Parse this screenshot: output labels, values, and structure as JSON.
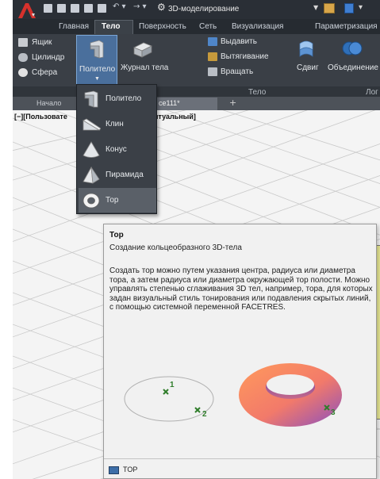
{
  "titlebar": {
    "workspace_label": "3D-моделирование",
    "icons": [
      "autocad-logo-icon",
      "new-icon",
      "open-icon",
      "save-icon",
      "saveas-icon",
      "print-icon",
      "undo-icon",
      "redo-icon",
      "gear-icon",
      "dropdown-icon"
    ]
  },
  "tabs": [
    {
      "label": "Главная",
      "active": false
    },
    {
      "label": "Тело",
      "active": true
    },
    {
      "label": "Поверхность",
      "active": false
    },
    {
      "label": "Сеть",
      "active": false
    },
    {
      "label": "Визуализация",
      "active": false
    },
    {
      "label": "Параметризация",
      "active": false
    }
  ],
  "ribbon": {
    "box_label": "Ящик",
    "cylinder_label": "Цилиндр",
    "sphere_label": "Сфера",
    "polysolid_label": "Политело",
    "history_label": "Журнал тела",
    "extrude_label": "Выдавить",
    "loft_label": "Вытягивание",
    "revolve_label": "Вращать",
    "sweep_label": "Сдвиг",
    "union_label": "Объединение",
    "panel_label": "Тело",
    "panel_label_2": "Лог"
  },
  "file_tabs": {
    "start_label": "Начало",
    "active_label": "ce111*",
    "plus_label": "+"
  },
  "viewport": {
    "label_left": "[−][Пользовате",
    "label_right": "птуальный]"
  },
  "dropdown": {
    "items": [
      {
        "label": "Политело",
        "icon": "polysolid-icon"
      },
      {
        "label": "Клин",
        "icon": "wedge-icon"
      },
      {
        "label": "Конус",
        "icon": "cone-icon"
      },
      {
        "label": "Пирамида",
        "icon": "pyramid-icon"
      },
      {
        "label": "Тор",
        "icon": "torus-icon"
      }
    ]
  },
  "tooltip": {
    "title": "Тор",
    "subtitle": "Создание кольцеобразного 3D-тела",
    "description": "Создать тор можно путем указания центра, радиуса или диаметра тора, а затем радиуса или диаметра окружающей тор полости. Можно управлять степенью сглаживания 3D тел, например, тора, для которых задан визуальный стиль тонирования или подавления скрытых линий, с помощью системной переменной FACETRES.",
    "point_1": "1",
    "point_2": "2",
    "point_3": "3",
    "footer_command": "TOP"
  },
  "colors": {
    "ribbon_bg": "#3a3f46",
    "accent_blue": "#4a6f9c",
    "torus_orange": "#ff8c50",
    "torus_purple": "#8a4fc0"
  }
}
